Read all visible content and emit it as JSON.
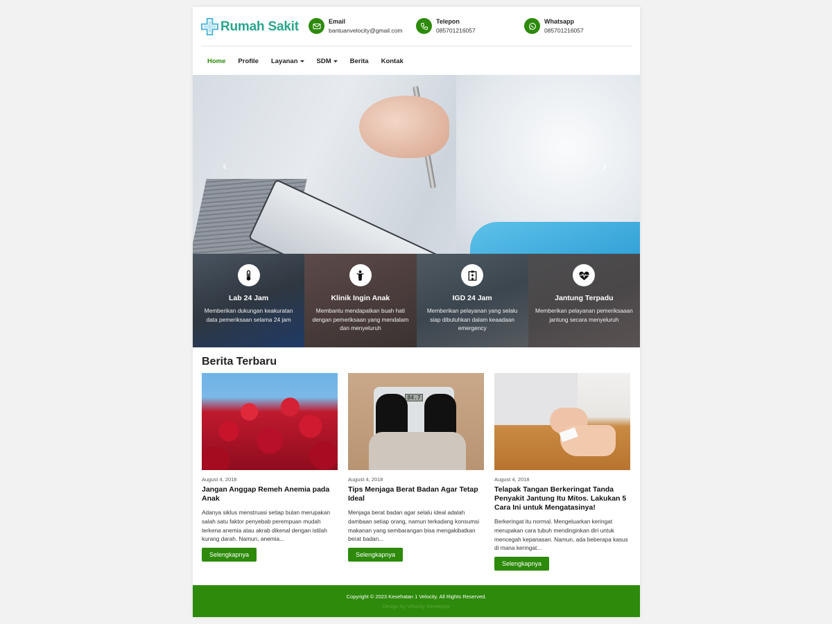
{
  "header": {
    "logo_text": "Rumah Sakit",
    "contacts": [
      {
        "label": "Email",
        "value": "bantuanvelocity@gmail.com",
        "icon": "mail-icon"
      },
      {
        "label": "Telepon",
        "value": "085701216057",
        "icon": "phone-icon"
      },
      {
        "label": "Whatsapp",
        "value": "085701216057",
        "icon": "whatsapp-icon"
      }
    ]
  },
  "nav": {
    "items": [
      "Home",
      "Profile",
      "Layanan",
      "SDM",
      "Berita",
      "Kontak"
    ],
    "active": "Home"
  },
  "hero": {
    "prev_label": "‹",
    "next_label": "›"
  },
  "features": [
    {
      "title": "Lab 24 Jam",
      "desc": "Memberikan dukungan keakuratan data pemeriksaan selama 24 jam",
      "icon": "thermometer-icon"
    },
    {
      "title": "Klinik Ingin Anak",
      "desc": "Membantu mendapatkan buah hati dengan pemeriksaan yang mendalam dan menyeluruh",
      "icon": "child-icon"
    },
    {
      "title": "IGD 24 Jam",
      "desc": "Memberikan pelayanan yang selalu siap dibutuhkan dalam keaadaan emergency",
      "icon": "hospital-icon"
    },
    {
      "title": "Jantung Terpadu",
      "desc": "Memberikan pelayanan pemeriksaaan jantung secara menyeluruh",
      "icon": "heartbeat-icon"
    }
  ],
  "news": {
    "heading": "Berita Terbaru",
    "button_label": "Selengkapnya",
    "items": [
      {
        "date": "August 4, 2018",
        "title": "Jangan Anggap Remeh Anemia pada Anak",
        "excerpt": "Adanya siklus menstruasi setiap bulan merupakan salah satu faktor penyebab perempuan mudah terkena anemia atau akrab dikenal dengan istilah kurang darah. Namun, anemia..."
      },
      {
        "date": "August 4, 2018",
        "title": "Tips Menjaga Berat Badan Agar Tetap Ideal",
        "excerpt": "Menjaga berat badan agar selalu ideal adalah dambaan setiap orang, namun terkadang konsumsi makanan yang sembarangan bisa mengakibatkan berat badan...",
        "scale_reading": "84.7"
      },
      {
        "date": "August 4, 2018",
        "title": "Telapak Tangan Berkeringat Tanda Penyakit Jantung Itu Mitos. Lakukan 5 Cara Ini untuk Mengatasinya!",
        "excerpt": "Berkeringat itu normal. Mengeluarkan keringat merupakan cara tubuh mendinginkan diri untuk mencegah kepanasan. Namun, ada beberapa kasus di mana keringat..."
      }
    ]
  },
  "footer": {
    "copyright": "Copyright © 2023 Kesehatan 1 Velocity. All Rights Reserved.",
    "credit": "Design by Velocity Developer"
  },
  "colors": {
    "primary": "#2d8a0b",
    "logo": "#2aa58e"
  }
}
